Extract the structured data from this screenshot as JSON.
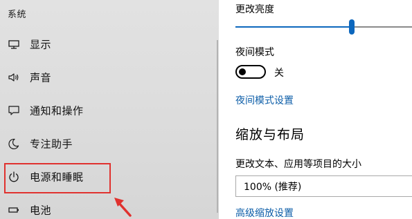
{
  "sidebar": {
    "section_title": "系统",
    "items": [
      {
        "label": "显示",
        "icon": "monitor-icon"
      },
      {
        "label": "声音",
        "icon": "speaker-icon"
      },
      {
        "label": "通知和操作",
        "icon": "notification-icon"
      },
      {
        "label": "专注助手",
        "icon": "moon-icon"
      },
      {
        "label": "电源和睡眠",
        "icon": "power-icon"
      },
      {
        "label": "电池",
        "icon": "battery-icon"
      }
    ],
    "highlighted_item": "电源和睡眠",
    "highlight_color": "#e0312e"
  },
  "content": {
    "brightness": {
      "label": "更改亮度",
      "value_fraction": 0.66
    },
    "night_light": {
      "label": "夜间模式",
      "toggle_state": "关",
      "is_on": false,
      "settings_link": "夜间模式设置"
    },
    "scale_layout": {
      "heading": "缩放与布局",
      "text_size_label": "更改文本、应用等项目的大小",
      "dropdown_value": "100% (推荐)",
      "advanced_link": "高级缩放设置"
    }
  },
  "colors": {
    "accent": "#0c67bd",
    "link": "#0d5ea8",
    "sidebar_bg": "#dddddd"
  }
}
